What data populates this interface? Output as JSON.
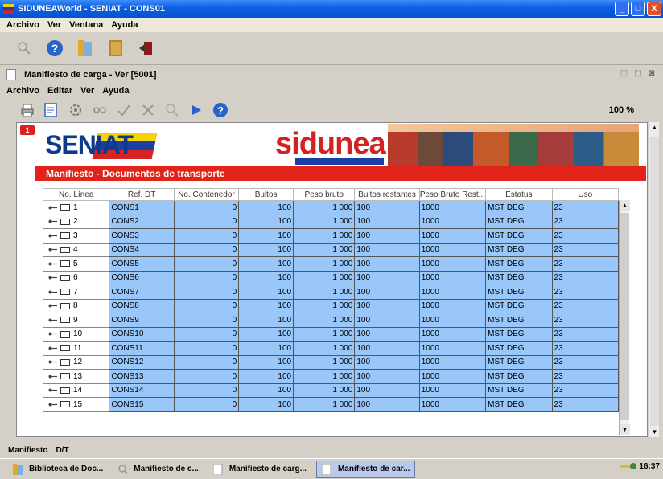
{
  "window": {
    "title": "SIDUNEAWorld - SENIAT - CONS01",
    "controls": [
      "_",
      "□",
      "X"
    ]
  },
  "app_menu": [
    "Archivo",
    "Ver",
    "Ventana",
    "Ayuda"
  ],
  "inner": {
    "title": "Manifiesto de carga - Ver [5001]",
    "menu": [
      "Archivo",
      "Editar",
      "Ver",
      "Ayuda"
    ],
    "zoom": "100 %",
    "doc_tab": "1"
  },
  "banner": {
    "seniat": "SENIAT",
    "sidunea": "sidunea"
  },
  "section_title": "Manifiesto - Documentos de transporte",
  "table": {
    "columns": [
      "No. Línea",
      "Ref. DT",
      "No. Contenedor",
      "Bultos",
      "Peso bruto",
      "Bultos restantes",
      "Peso Bruto Rest...",
      "Estatus",
      "Uso"
    ],
    "rows": [
      {
        "line": "1",
        "ref": "CONS1",
        "cont": "0",
        "bultos": "100",
        "peso": "1 000",
        "rest": "100",
        "peso_rest": "1000",
        "estatus": "MST DEG",
        "uso": "23"
      },
      {
        "line": "2",
        "ref": "CONS2",
        "cont": "0",
        "bultos": "100",
        "peso": "1 000",
        "rest": "100",
        "peso_rest": "1000",
        "estatus": "MST DEG",
        "uso": "23"
      },
      {
        "line": "3",
        "ref": "CONS3",
        "cont": "0",
        "bultos": "100",
        "peso": "1 000",
        "rest": "100",
        "peso_rest": "1000",
        "estatus": "MST DEG",
        "uso": "23"
      },
      {
        "line": "4",
        "ref": "CONS4",
        "cont": "0",
        "bultos": "100",
        "peso": "1 000",
        "rest": "100",
        "peso_rest": "1000",
        "estatus": "MST DEG",
        "uso": "23"
      },
      {
        "line": "5",
        "ref": "CONS5",
        "cont": "0",
        "bultos": "100",
        "peso": "1 000",
        "rest": "100",
        "peso_rest": "1000",
        "estatus": "MST DEG",
        "uso": "23"
      },
      {
        "line": "6",
        "ref": "CONS6",
        "cont": "0",
        "bultos": "100",
        "peso": "1 000",
        "rest": "100",
        "peso_rest": "1000",
        "estatus": "MST DEG",
        "uso": "23"
      },
      {
        "line": "7",
        "ref": "CONS7",
        "cont": "0",
        "bultos": "100",
        "peso": "1 000",
        "rest": "100",
        "peso_rest": "1000",
        "estatus": "MST DEG",
        "uso": "23"
      },
      {
        "line": "8",
        "ref": "CONS8",
        "cont": "0",
        "bultos": "100",
        "peso": "1 000",
        "rest": "100",
        "peso_rest": "1000",
        "estatus": "MST DEG",
        "uso": "23"
      },
      {
        "line": "9",
        "ref": "CONS9",
        "cont": "0",
        "bultos": "100",
        "peso": "1 000",
        "rest": "100",
        "peso_rest": "1000",
        "estatus": "MST DEG",
        "uso": "23"
      },
      {
        "line": "10",
        "ref": "CONS10",
        "cont": "0",
        "bultos": "100",
        "peso": "1 000",
        "rest": "100",
        "peso_rest": "1000",
        "estatus": "MST DEG",
        "uso": "23"
      },
      {
        "line": "11",
        "ref": "CONS11",
        "cont": "0",
        "bultos": "100",
        "peso": "1 000",
        "rest": "100",
        "peso_rest": "1000",
        "estatus": "MST DEG",
        "uso": "23"
      },
      {
        "line": "12",
        "ref": "CONS12",
        "cont": "0",
        "bultos": "100",
        "peso": "1 000",
        "rest": "100",
        "peso_rest": "1000",
        "estatus": "MST DEG",
        "uso": "23"
      },
      {
        "line": "13",
        "ref": "CONS13",
        "cont": "0",
        "bultos": "100",
        "peso": "1 000",
        "rest": "100",
        "peso_rest": "1000",
        "estatus": "MST DEG",
        "uso": "23"
      },
      {
        "line": "14",
        "ref": "CONS14",
        "cont": "0",
        "bultos": "100",
        "peso": "1 000",
        "rest": "100",
        "peso_rest": "1000",
        "estatus": "MST DEG",
        "uso": "23"
      },
      {
        "line": "15",
        "ref": "CONS15",
        "cont": "0",
        "bultos": "100",
        "peso": "1 000",
        "rest": "100",
        "peso_rest": "1000",
        "estatus": "MST DEG",
        "uso": "23"
      }
    ]
  },
  "bottom_tabs": [
    "Manifiesto",
    "D/T"
  ],
  "taskbar": {
    "items": [
      "Biblioteca de Doc...",
      "Manifiesto de c...",
      "Manifiesto de carg...",
      "Manifiesto de car..."
    ],
    "clock": "16:37"
  },
  "colors": {
    "row_fill": "#99c7fa",
    "section_bar": "#e2231a",
    "title_bar": "#0a5fe0"
  }
}
